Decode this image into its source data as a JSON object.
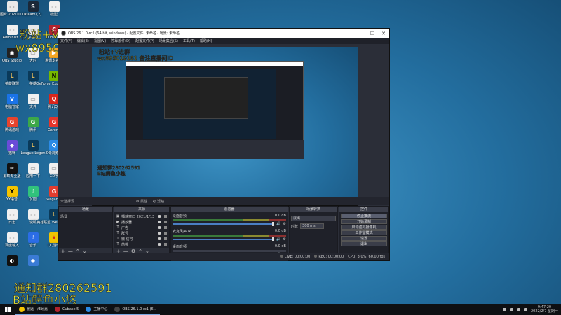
{
  "desktop": {
    "icons": [
      {
        "label": "QQ图片 20210118...",
        "glyph": "▭",
        "color": "#e8e8e8",
        "fg": "#666"
      },
      {
        "label": "steam (2)",
        "glyph": "S",
        "color": "#1b2838",
        "fg": "#fff"
      },
      {
        "label": "模型",
        "glyph": "▭",
        "color": "#f0f0f0",
        "fg": "#888"
      },
      {
        "label": "Administ...",
        "glyph": "▭",
        "color": "#f0f0f0",
        "fg": "#888"
      },
      {
        "label": "平面ui",
        "glyph": "▭",
        "color": "#e8e8e8",
        "fg": "#888"
      },
      {
        "label": "Cubase 5",
        "glyph": "C",
        "color": "#b0232e",
        "fg": "#fff"
      },
      {
        "label": "OBS Studio",
        "glyph": "◉",
        "color": "#222",
        "fg": "#fff"
      },
      {
        "label": "大时",
        "glyph": "▭",
        "color": "#f0f0f0",
        "fg": "#888"
      },
      {
        "label": "腾讯影视库",
        "glyph": "▶",
        "color": "#f5a623",
        "fg": "#fff"
      },
      {
        "label": "英雄联盟",
        "glyph": "L",
        "color": "#0a3a5a",
        "fg": "#d9b45a"
      },
      {
        "label": "英雄",
        "glyph": "L",
        "color": "#0a3a5a",
        "fg": "#d9b45a"
      },
      {
        "label": "GeForce Experience",
        "glyph": "N",
        "color": "#76b900",
        "fg": "#000"
      },
      {
        "label": "电脑管家",
        "glyph": "V",
        "color": "#1a73e8",
        "fg": "#fff"
      },
      {
        "label": "文件",
        "glyph": "▭",
        "color": "#f0f0f0",
        "fg": "#888"
      },
      {
        "label": "腾讯QQ",
        "glyph": "Q",
        "color": "#d9261c",
        "fg": "#fff"
      },
      {
        "label": "腾讯游戏",
        "glyph": "G",
        "color": "#e6442e",
        "fg": "#fff"
      },
      {
        "label": "腾讯",
        "glyph": "G",
        "color": "#3ca848",
        "fg": "#fff"
      },
      {
        "label": "Garena",
        "glyph": "G",
        "color": "#e5352c",
        "fg": "#fff"
      },
      {
        "label": "猫咪",
        "glyph": "◆",
        "color": "#6a4cd8",
        "fg": "#fff"
      },
      {
        "label": "League Legen",
        "glyph": "L",
        "color": "#0a3a5a",
        "fg": "#d9b45a"
      },
      {
        "label": "QQ浏览器",
        "glyph": "Q",
        "color": "#2b8be6",
        "fg": "#fff"
      },
      {
        "label": "剪映专业版",
        "glyph": "✂",
        "color": "#111",
        "fg": "#fff"
      },
      {
        "label": "应用一下",
        "glyph": "▭",
        "color": "#f0f0f0",
        "fg": "#888"
      },
      {
        "label": "CD序",
        "glyph": "▭",
        "color": "#f0f0f0",
        "fg": "#888"
      },
      {
        "label": "YY语音",
        "glyph": "Y",
        "color": "#f5c400",
        "fg": "#000"
      },
      {
        "label": "QQ音",
        "glyph": "♪",
        "color": "#31c27c",
        "fg": "#fff"
      },
      {
        "label": "wegame",
        "glyph": "G",
        "color": "#e33d2f",
        "fg": "#fff"
      },
      {
        "label": "日志",
        "glyph": "▭",
        "color": "#f0f0f0",
        "fg": "#888"
      },
      {
        "label": "说明",
        "glyph": "▭",
        "color": "#f0f0f0",
        "fg": "#888"
      },
      {
        "label": "英雄联盟 WeGame版",
        "glyph": "L",
        "color": "#0a3a5a",
        "fg": "#d9b45a"
      },
      {
        "label": "百度输入",
        "glyph": "▭",
        "color": "#f0f0f0",
        "fg": "#888"
      },
      {
        "label": "音乐",
        "glyph": "♪",
        "color": "#2b6de6",
        "fg": "#fff"
      },
      {
        "label": "QQ游戏",
        "glyph": "★",
        "color": "#f2c400",
        "fg": "#d9261c"
      },
      {
        "label": "",
        "glyph": "◐",
        "color": "#111",
        "fg": "#fff"
      },
      {
        "label": "",
        "glyph": "◆",
        "color": "#3a7bd5",
        "fg": "#fff"
      }
    ]
  },
  "overlays": {
    "top_line1": "粉站+V进群",
    "top_line2": "wx895019181 备注直播间ID",
    "bottom_line1": "通知群280262591",
    "bottom_line2": "B站鳄鱼小悠"
  },
  "obs": {
    "title": "OBS 26.1.0-rc1 (64-bit, windows) - 配置文件: 未命名 - 场景: 未命名",
    "menu": [
      "文件(F)",
      "编辑(E)",
      "视图(V)",
      "停靠部件(D)",
      "配置文件(P)",
      "场景集合(S)",
      "工具(T)",
      "帮助(H)"
    ],
    "inner_overlay_top1": "粉站+V进群",
    "inner_overlay_top2": "wx895019181 备注直播间ID",
    "inner_overlay_bot1": "通知群280262591",
    "inner_overlay_bot2": "B站鳄鱼小悠",
    "context": {
      "label": "未选择源",
      "properties": "属性",
      "filters": "滤镜"
    },
    "docks": {
      "scenes": {
        "title": "场景",
        "items": [
          "场景"
        ]
      },
      "sources": {
        "title": "来源",
        "items": [
          {
            "icon": "▣",
            "name": "捕获窗口 2021/1/13"
          },
          {
            "icon": "▶",
            "name": "播放器"
          },
          {
            "icon": "T",
            "name": "广告"
          },
          {
            "icon": "T",
            "name": "群号"
          },
          {
            "icon": "T",
            "name": "微 信号"
          },
          {
            "icon": "T",
            "name": "前排"
          }
        ]
      },
      "mixer": {
        "title": "混音器",
        "channels": [
          {
            "name": "桌面音频",
            "db": "0.0 dB",
            "level": 0.85
          },
          {
            "name": "麦克风/Aux",
            "db": "0.0 dB",
            "level": 0.82
          },
          {
            "name": "桌面音频",
            "db": "0.0 dB",
            "level": 0
          }
        ]
      },
      "transitions": {
        "title": "场景转换",
        "selected": "淡出",
        "duration_label": "时长",
        "duration": "300 ms"
      },
      "controls": {
        "title": "控件",
        "buttons": [
          "停止推流",
          "开始录制",
          "启动虚拟摄像机",
          "工作室模式",
          "设置",
          "退出"
        ]
      }
    },
    "status": {
      "live": "LIVE: 00:00:00",
      "rec": "REC: 00:00:00",
      "cpu": "CPU: 3.0%, 60.00 fps"
    }
  },
  "taskbar": {
    "items": [
      {
        "label": "敏远 - 淮颐嘉",
        "color": "#f5c400"
      },
      {
        "label": "Cubase 5",
        "color": "#b0232e"
      },
      {
        "label": "主播中心",
        "color": "#2b8be6"
      },
      {
        "label": "OBS 26.1.0-rc1 (6...",
        "color": "#444"
      }
    ],
    "time": "9:47:20",
    "date": "2022/2/7 星期一"
  }
}
